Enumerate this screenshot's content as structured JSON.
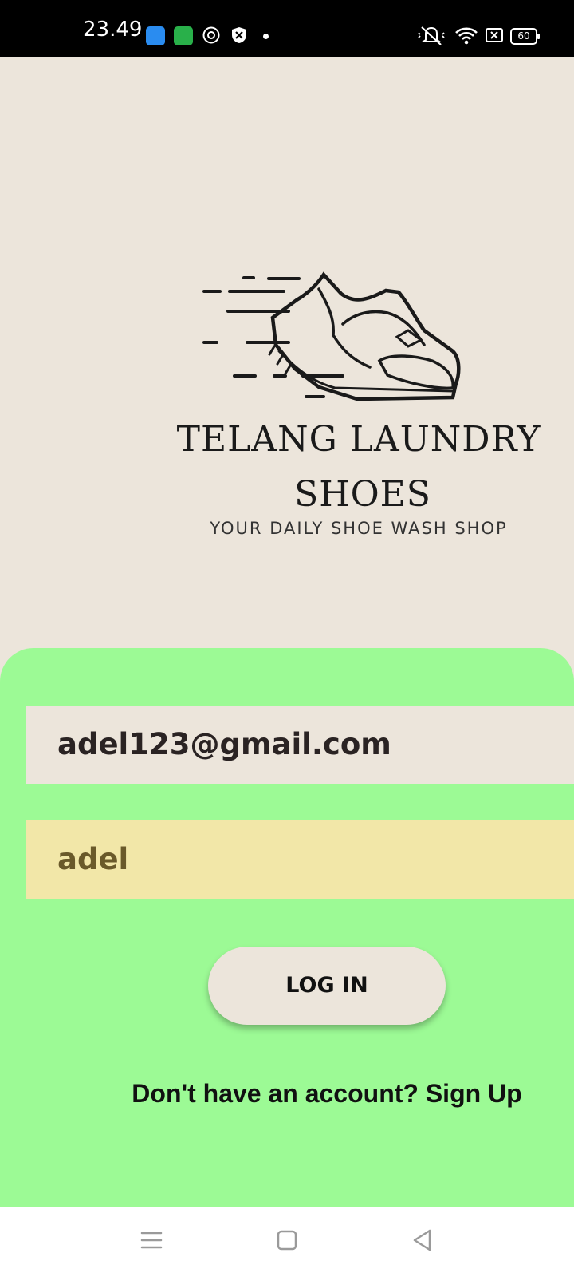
{
  "status_bar": {
    "time": "23.49",
    "battery": "60",
    "icons": [
      "app-blue-icon",
      "app-green-icon",
      "vpn-circle-icon",
      "shield-icon",
      "notification-dot",
      "mute-icon",
      "wifi-icon",
      "sim-icon",
      "battery-icon"
    ]
  },
  "brand": {
    "logo_icon": "running-shoe-icon",
    "name_line1": "TELANG LAUNDRY",
    "name_line2": "SHOES",
    "tagline": "YOUR DAILY SHOE WASH SHOP"
  },
  "form": {
    "email_value": "adel123@gmail.com",
    "password_value": "adel",
    "login_label": "LOG IN",
    "signup_text": "Don't have an account? Sign Up"
  },
  "colors": {
    "background": "#ece5db",
    "panel": "#9cfa95",
    "password_field": "#f2e7a8",
    "status_bar": "#000000",
    "nav_bar": "#ffffff"
  },
  "nav": {
    "icons": [
      "menu-icon",
      "home-square-icon",
      "back-triangle-icon"
    ]
  }
}
